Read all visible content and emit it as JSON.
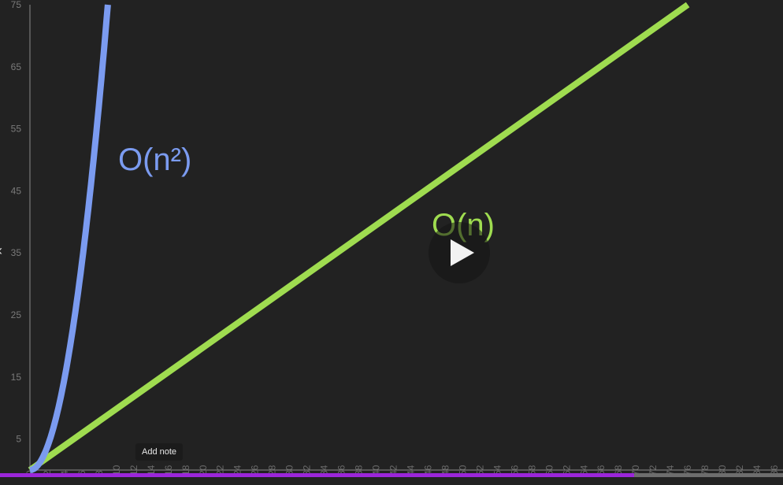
{
  "chart_data": {
    "type": "line",
    "ylim": [
      0,
      75
    ],
    "y_ticks": [
      "5",
      "15",
      "25",
      "35",
      "45",
      "55",
      "65",
      "75"
    ],
    "x_ticks": [
      "0",
      "2",
      "4",
      "6",
      "8",
      "10",
      "12",
      "14",
      "16",
      "18",
      "20",
      "22",
      "24",
      "26",
      "28",
      "30",
      "32",
      "34",
      "36",
      "38",
      "40",
      "42",
      "44",
      "46",
      "48",
      "50",
      "52",
      "54",
      "56",
      "58",
      "60",
      "62",
      "64",
      "66",
      "68",
      "70",
      "72",
      "74",
      "76",
      "78",
      "80",
      "82",
      "84",
      "86"
    ],
    "xlim": [
      0,
      87
    ],
    "series": [
      {
        "name": "O(n)",
        "kind": "linear",
        "points": [
          [
            0,
            0
          ],
          [
            76,
            75
          ]
        ],
        "color": "#9fdc50"
      },
      {
        "name": "O(n²)",
        "kind": "quadratic",
        "points": [
          [
            0,
            0
          ],
          [
            2,
            3
          ],
          [
            4,
            11
          ],
          [
            6,
            27
          ],
          [
            8,
            52
          ],
          [
            9,
            75
          ]
        ],
        "color": "#7b9bf0"
      }
    ],
    "labels": [
      {
        "id": "on2",
        "text": "O(n²)",
        "color": "#7b9bf0"
      },
      {
        "id": "on",
        "text": "O(n)",
        "color": "#9fdc50"
      }
    ],
    "grid": false
  },
  "video": {
    "add_note_label": "Add note",
    "progress": 0.81,
    "progress_color": "#9b26d9"
  }
}
